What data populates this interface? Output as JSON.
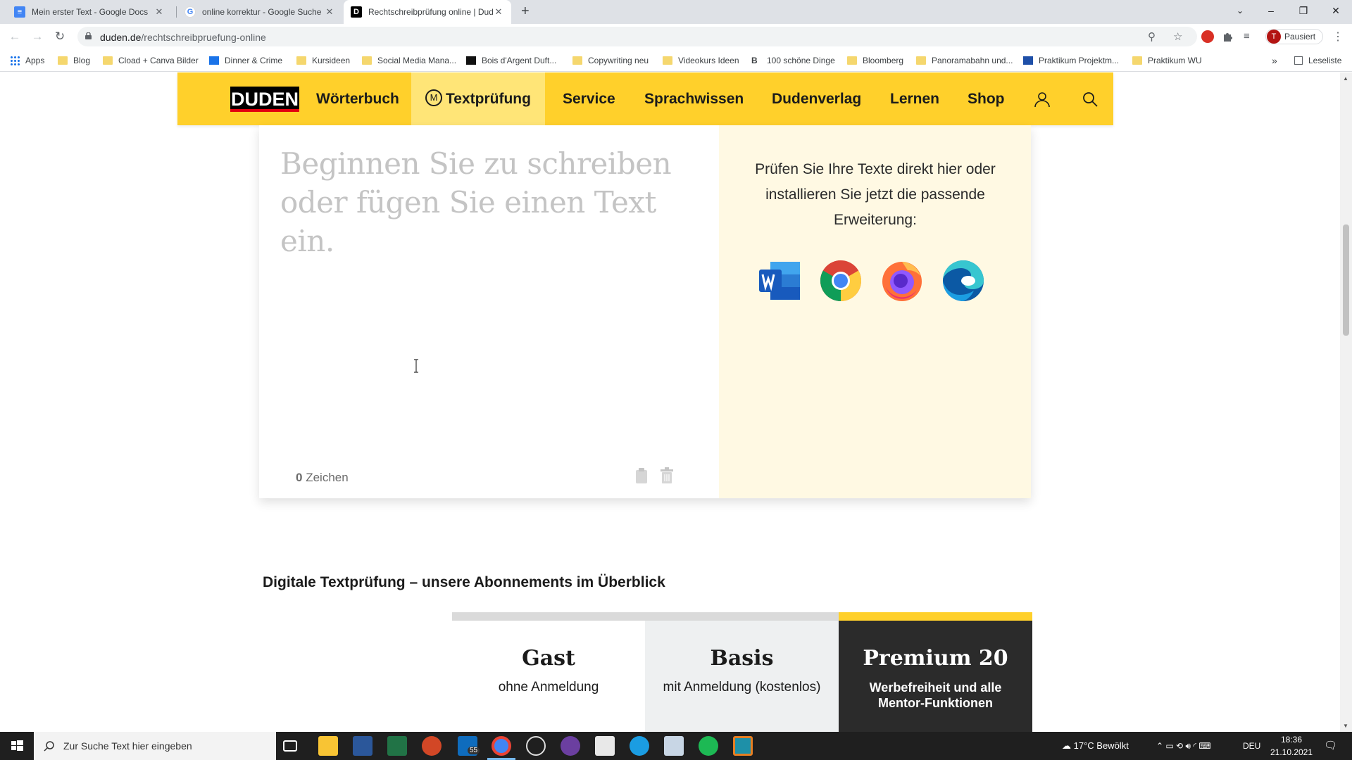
{
  "browser": {
    "tabs": [
      {
        "title": "Mein erster Text - Google Docs",
        "icon": "google-docs-icon"
      },
      {
        "title": "online korrektur - Google Suche",
        "icon": "google-icon"
      },
      {
        "title": "Rechtschreibprüfung online | Duden",
        "icon": "duden-icon"
      }
    ],
    "url_domain": "duden.de",
    "url_path": "/rechtschreibpruefung-online",
    "profile_initial": "T",
    "profile_label": "Pausiert",
    "bookmarks": [
      {
        "label": "Apps",
        "icon": "apps-grid-icon"
      },
      {
        "label": "Blog",
        "icon": "folder-icon"
      },
      {
        "label": "Cload + Canva Bilder",
        "icon": "folder-icon"
      },
      {
        "label": "Dinner & Crime",
        "icon": "jimdo-icon"
      },
      {
        "label": "Kursideen",
        "icon": "folder-icon"
      },
      {
        "label": "Social Media Mana...",
        "icon": "folder-icon"
      },
      {
        "label": "Bois d'Argent Duft...",
        "icon": "site-icon"
      },
      {
        "label": "Copywriting neu",
        "icon": "folder-icon"
      },
      {
        "label": "Videokurs Ideen",
        "icon": "folder-icon"
      },
      {
        "label": "100 schöne Dinge",
        "icon": "b-icon"
      },
      {
        "label": "Bloomberg",
        "icon": "folder-icon"
      },
      {
        "label": "Panoramabahn und...",
        "icon": "folder-icon"
      },
      {
        "label": "Praktikum Projektm...",
        "icon": "j-icon"
      },
      {
        "label": "Praktikum WU",
        "icon": "folder-icon"
      }
    ],
    "bookmarks_more": "»",
    "reading_list": "Leseliste"
  },
  "duden": {
    "logo": "DUDEN",
    "nav": [
      "Wörterbuch",
      "Textprüfung",
      "Service",
      "Sprachwissen",
      "Dudenverlag",
      "Lernen",
      "Shop"
    ],
    "mentor_badge": "M",
    "editor_placeholder": "Beginnen Sie zu schreiben oder fügen Sie einen Text ein.",
    "char_count": "0",
    "char_label": "Zeichen",
    "extension_text": "Prüfen Sie Ihre Texte direkt hier oder installieren Sie jetzt die passende Erweiterung:",
    "extensions": [
      "word-icon",
      "chrome-icon",
      "firefox-icon",
      "edge-icon"
    ],
    "section_title": "Digitale Textprüfung – unsere Abonnements im Überblick",
    "plans": [
      {
        "name": "Gast",
        "sub": "ohne Anmeldung",
        "bar_color": "#dadada",
        "bg": "#ffffff",
        "fg": "#1b1b1b"
      },
      {
        "name": "Basis",
        "sub": "mit Anmeldung (kostenlos)",
        "bar_color": "#dadada",
        "bg": "#eef0f1",
        "fg": "#1b1b1b"
      },
      {
        "name": "Premium 20",
        "sub": "Werbefreiheit und alle Mentor-Funktionen",
        "bar_color": "#ffd02b",
        "bg": "#2b2b2b",
        "fg": "#ffffff"
      }
    ],
    "colors": {
      "brand_yellow": "#ffd02b",
      "panel_bg": "#fff9e3"
    }
  },
  "taskbar": {
    "search_placeholder": "Zur Suche Text hier eingeben",
    "mail_badge": "55",
    "weather": "17°C  Bewölkt",
    "language": "DEU",
    "time": "18:36",
    "date": "21.10.2021"
  }
}
